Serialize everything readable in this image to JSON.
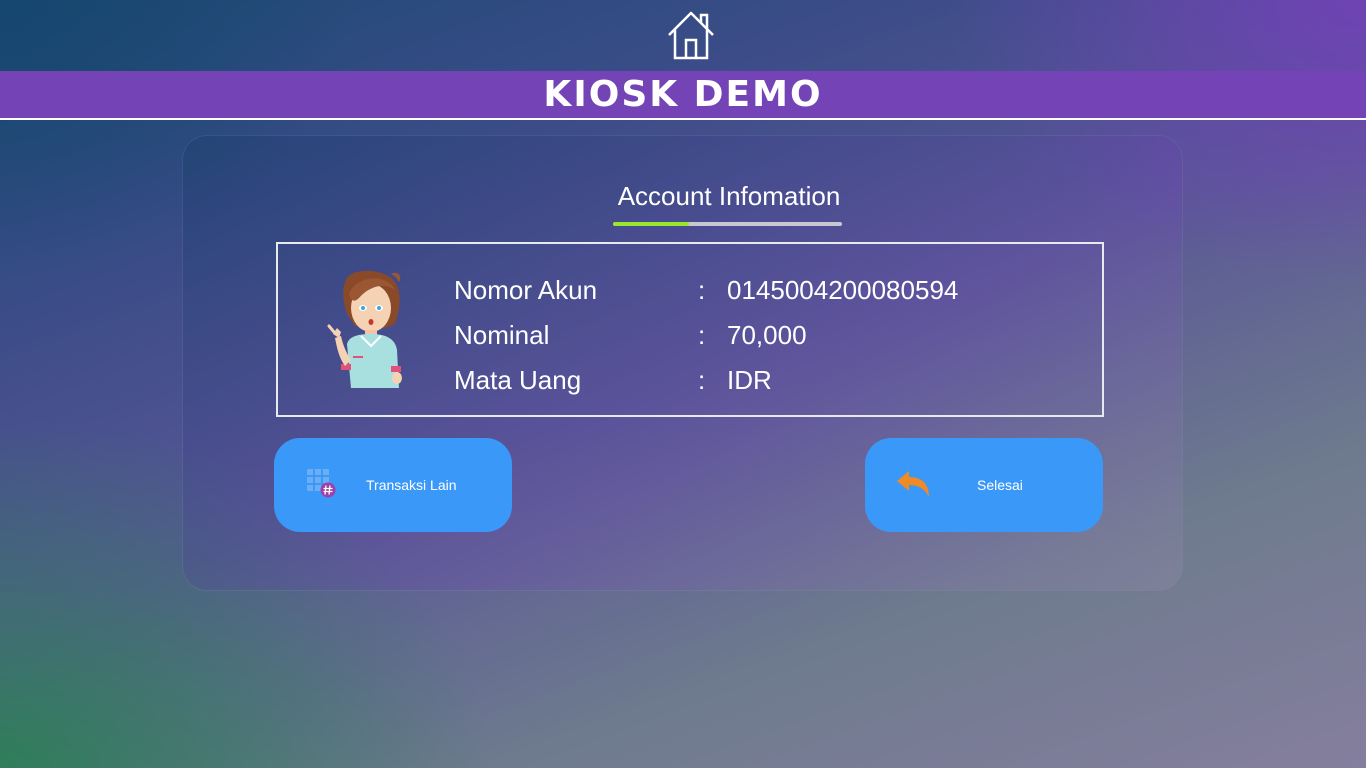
{
  "header": {
    "home_icon": "house-icon",
    "title": "KIOSK DEMO"
  },
  "card": {
    "title": "Account Infomation",
    "progress": 0.33,
    "colors": {
      "progress_fill": "#9ae62e",
      "progress_track": "#c8c8d2"
    },
    "avatar_icon": "customer-service-woman-icon",
    "rows": [
      {
        "label": "Nomor Akun",
        "separator": ":",
        "value": "0145004200080594"
      },
      {
        "label": "Nominal",
        "separator": ":",
        "value": "70,000"
      },
      {
        "label": "Mata Uang",
        "separator": ":",
        "value": "IDR"
      }
    ]
  },
  "buttons": {
    "other": {
      "label": "Transaksi Lain",
      "icon": "keypad-hash-icon"
    },
    "done": {
      "label": "Selesai",
      "icon": "undo-arrow-icon"
    }
  },
  "colors": {
    "title_bar": "#7443b6",
    "button": "#3a98f8",
    "accent_orange": "#f08a24"
  }
}
